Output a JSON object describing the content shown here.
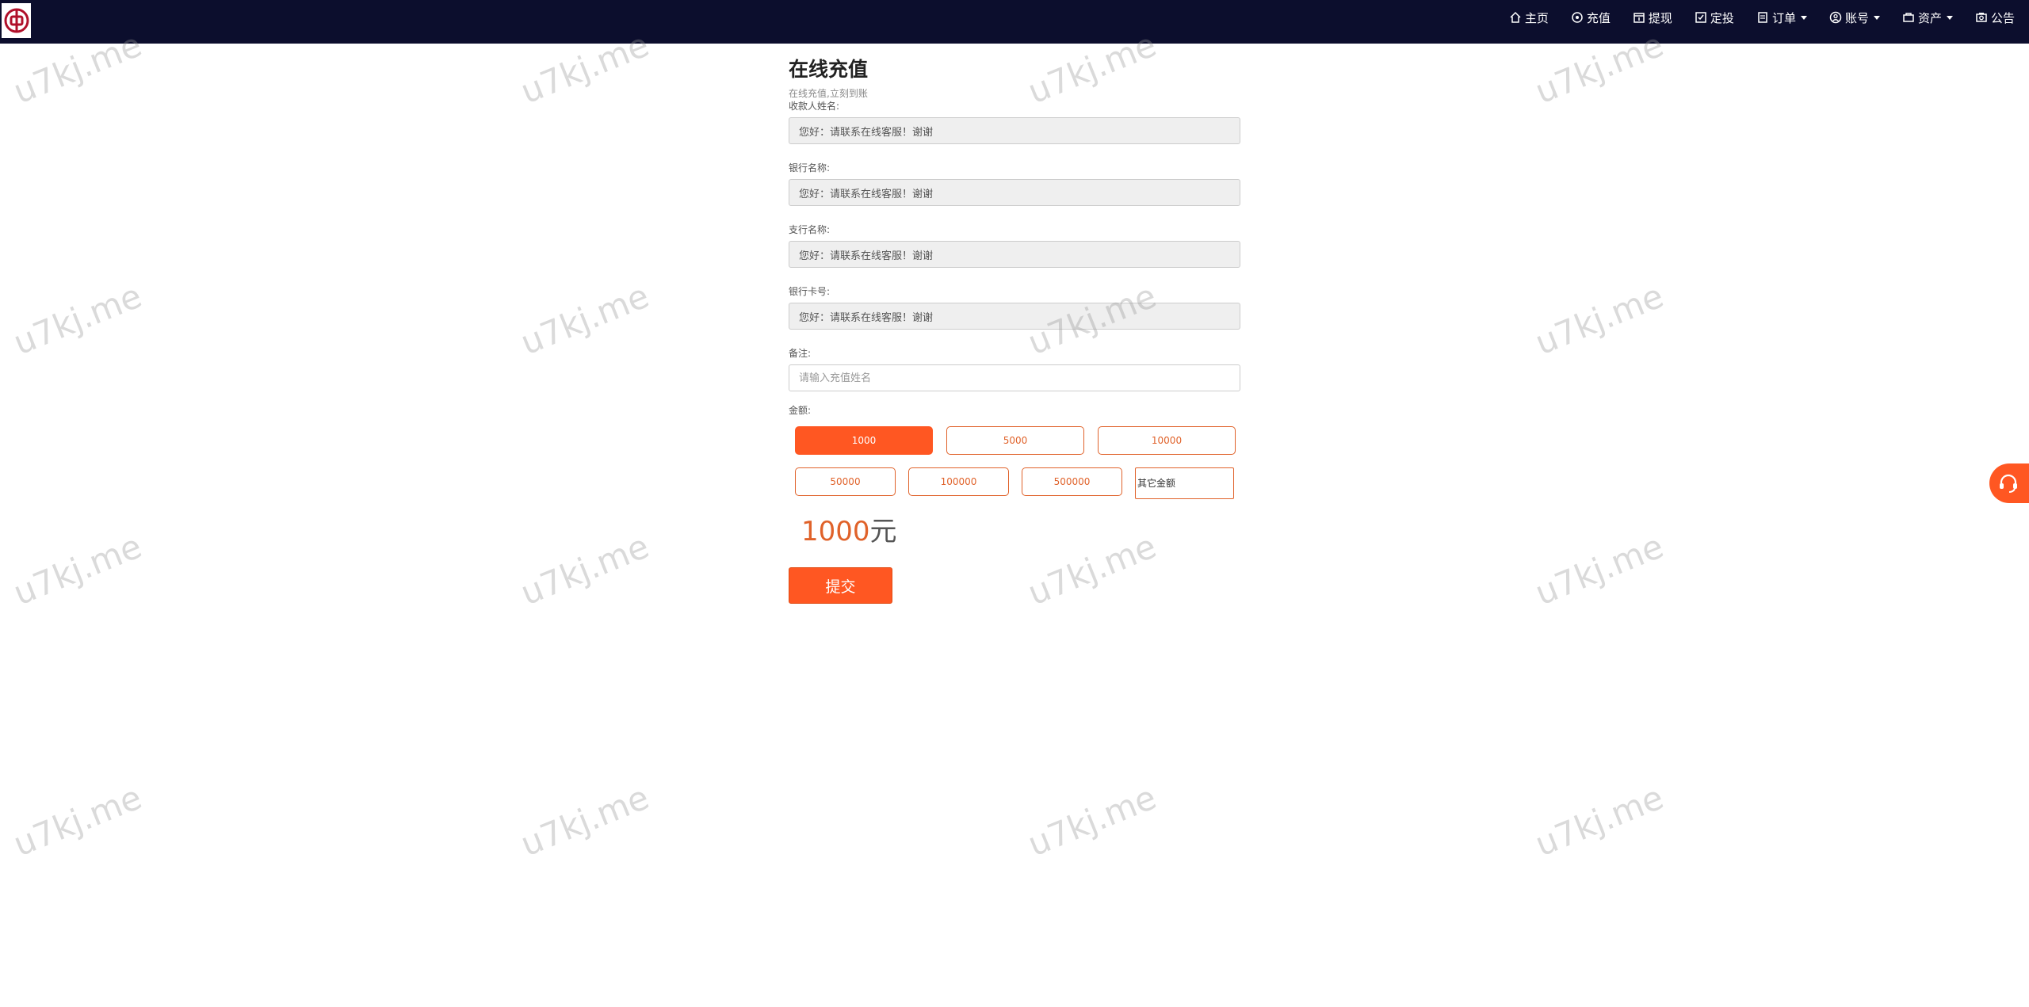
{
  "header": {
    "logo_icon": "bank-of-china-logo",
    "nav": [
      {
        "label": "主页",
        "icon": "home-icon",
        "dropdown": false
      },
      {
        "label": "充值",
        "icon": "recharge-icon",
        "dropdown": false
      },
      {
        "label": "提现",
        "icon": "withdraw-icon",
        "dropdown": false
      },
      {
        "label": "定投",
        "icon": "invest-icon",
        "dropdown": false
      },
      {
        "label": "订单",
        "icon": "order-icon",
        "dropdown": true
      },
      {
        "label": "账号",
        "icon": "account-icon",
        "dropdown": true
      },
      {
        "label": "资产",
        "icon": "assets-icon",
        "dropdown": true
      },
      {
        "label": "公告",
        "icon": "notice-icon",
        "dropdown": false
      }
    ]
  },
  "watermark": "u7kj.me",
  "form": {
    "title": "在线充值",
    "subtitle": "在线充值,立刻到账",
    "fields": [
      {
        "label": "收款人姓名:",
        "value": "您好：请联系在线客服！谢谢"
      },
      {
        "label": "银行名称:",
        "value": "您好：请联系在线客服！谢谢"
      },
      {
        "label": "支行名称:",
        "value": "您好：请联系在线客服！谢谢"
      },
      {
        "label": "银行卡号:",
        "value": "您好：请联系在线客服！谢谢"
      }
    ],
    "remark": {
      "label": "备注:",
      "placeholder": "请输入充值姓名"
    },
    "amount_label": "金额:",
    "amounts_row1": [
      "1000",
      "5000",
      "10000"
    ],
    "amounts_row2": [
      "50000",
      "100000",
      "500000"
    ],
    "selected_amount": "1000",
    "other_placeholder": "其它金额",
    "display_amount": "1000",
    "display_unit": "元",
    "submit_label": "提交"
  },
  "colors": {
    "nav_bg": "#0c0e2d",
    "accent": "#ff5722",
    "accent_text": "#e0622a"
  }
}
